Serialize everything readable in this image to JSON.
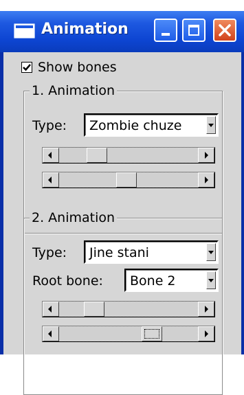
{
  "window": {
    "title": "Animation"
  },
  "show_bones": {
    "label": "Show bones",
    "checked": true
  },
  "animation1": {
    "legend": "1. Animation",
    "type_label": "Type:",
    "type_value": "Zombie chuze",
    "scroll1_value": 0.23,
    "scroll2_value": 0.48
  },
  "animation2": {
    "legend": "2. Animation",
    "type_label": "Type:",
    "type_value": "Jine stani",
    "root_label": "Root bone:",
    "root_value": "Bone 2",
    "scroll1_value": 0.21,
    "scroll2_value": 0.7
  },
  "icons": [
    "app-window-icon",
    "minimize-icon",
    "maximize-icon",
    "close-icon",
    "checkmark-icon",
    "dropdown-arrow-icon",
    "scroll-left-arrow-icon",
    "scroll-right-arrow-icon"
  ]
}
